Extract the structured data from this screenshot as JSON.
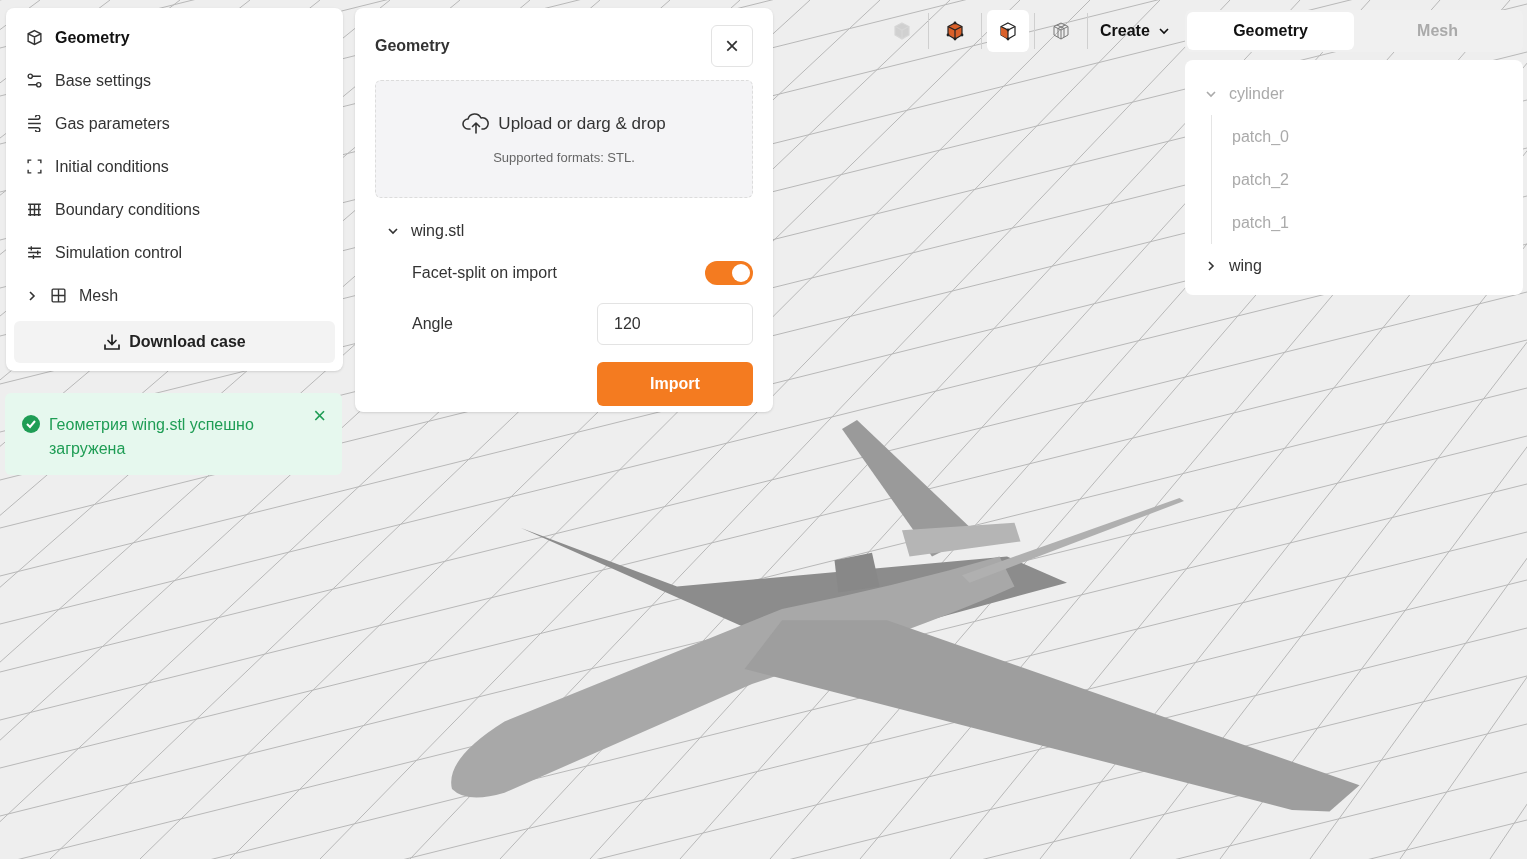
{
  "sidebar": {
    "items": [
      {
        "label": "Geometry",
        "kind": "item",
        "selected": true
      },
      {
        "label": "Base settings",
        "kind": "item",
        "selected": false
      },
      {
        "label": "Gas parameters",
        "kind": "item",
        "selected": false
      },
      {
        "label": "Initial conditions",
        "kind": "item",
        "selected": false
      },
      {
        "label": "Boundary conditions",
        "kind": "item",
        "selected": false
      },
      {
        "label": "Simulation control",
        "kind": "item",
        "selected": false
      },
      {
        "label": "Mesh",
        "kind": "group",
        "selected": false,
        "expanded": false
      }
    ],
    "download_button": "Download case"
  },
  "toast": {
    "kind": "success",
    "message": "Геометрия wing.stl успешно загружена",
    "close": "×"
  },
  "geometry_panel": {
    "title": "Geometry",
    "close": "×",
    "upload": {
      "label": "Upload or darg & drop",
      "hint": "Supported formats: STL."
    },
    "file": {
      "name": "wing.stl",
      "expanded": true
    },
    "facet_split": {
      "label": "Facet-split on import",
      "on": true
    },
    "angle": {
      "label": "Angle",
      "value": "120"
    },
    "import_button": "Import"
  },
  "toolbar": {
    "view_buttons": [
      {
        "selected": false,
        "disabled": true
      },
      {
        "selected": false,
        "disabled": false
      },
      {
        "selected": true,
        "disabled": false
      },
      {
        "selected": false,
        "disabled": false
      }
    ],
    "create_menu": "Create"
  },
  "right_tabs": [
    {
      "label": "Geometry",
      "selected": true
    },
    {
      "label": "Mesh",
      "selected": false
    }
  ],
  "tree": [
    {
      "label": "cylinder",
      "expanded": true,
      "dimmed": true,
      "children": [
        {
          "label": "patch_0",
          "dimmed": true
        },
        {
          "label": "patch_2",
          "dimmed": true
        },
        {
          "label": "patch_1",
          "dimmed": true
        }
      ]
    },
    {
      "label": "wing",
      "expanded": false,
      "dimmed": false
    }
  ]
}
